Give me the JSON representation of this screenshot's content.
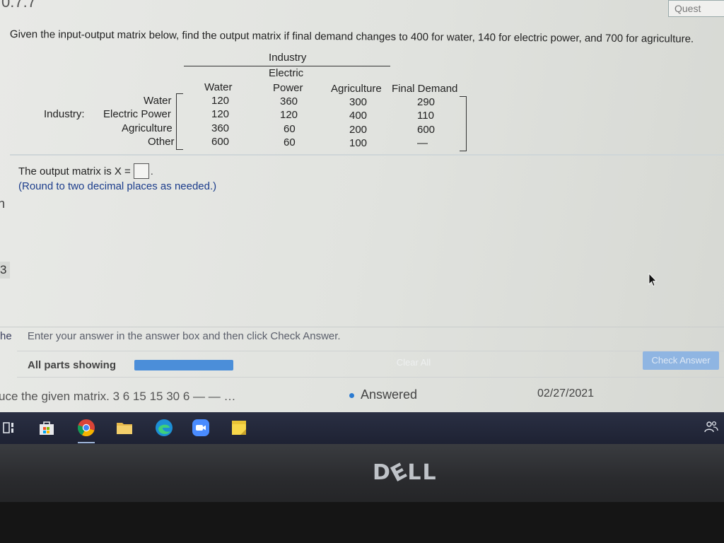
{
  "header": {
    "section_number": "0.7.7",
    "question_link": "Quest"
  },
  "question": {
    "text": "Given the input-output matrix below, find the output matrix if final demand changes to 400 for water, 140 for electric power, and 700 for agriculture."
  },
  "matrix": {
    "group_label_top": "Industry",
    "group_label_side": "Industry:",
    "columns": [
      {
        "line1": "",
        "line2": "Water"
      },
      {
        "line1": "Electric",
        "line2": "Power"
      },
      {
        "line1": "",
        "line2": "Agriculture"
      },
      {
        "line1": "",
        "line2": "Final Demand"
      }
    ],
    "rows": [
      {
        "label": "Water",
        "values": [
          "120",
          "360",
          "300",
          "290"
        ]
      },
      {
        "label": "Electric Power",
        "values": [
          "120",
          "120",
          "400",
          "110"
        ]
      },
      {
        "label": "Agriculture",
        "values": [
          "360",
          "60",
          "200",
          "600"
        ]
      },
      {
        "label": "Other",
        "values": [
          "600",
          "60",
          "100",
          "—"
        ]
      }
    ]
  },
  "answer": {
    "prompt": "The output matrix is X =",
    "period": ".",
    "note": "(Round to two decimal places as needed.)"
  },
  "side_marks": {
    "n": "n",
    "three": "3"
  },
  "footer": {
    "instruction_cut": "he",
    "instruction": "Enter your answer in the answer box and then click Check Answer.",
    "parts_label": "All parts showing",
    "clear_all": "Clear All",
    "check_answer": "Check Answer"
  },
  "status": {
    "title": "uce the given matrix. 3 6 15 15 30 6 — — …",
    "answered": "Answered",
    "date": "02/27/2021"
  },
  "bezel": {
    "brand": "DELL"
  },
  "colors": {
    "accent_blue": "#4b8ed9",
    "check_button": "#8fb5e2",
    "note_blue": "#1c3d8c",
    "taskbar": "#232839"
  }
}
